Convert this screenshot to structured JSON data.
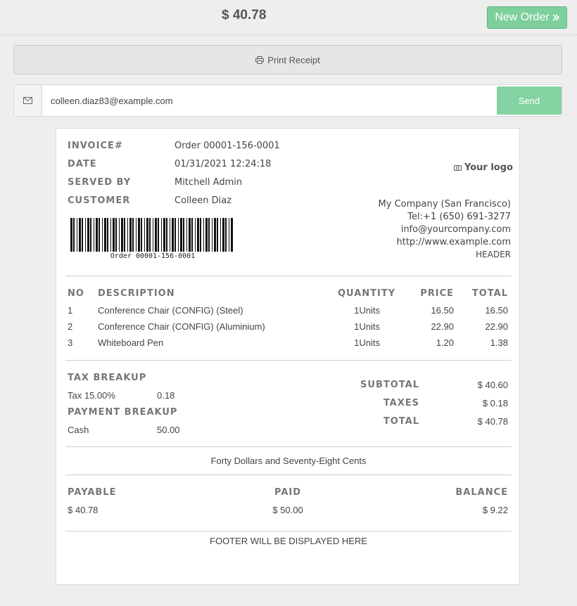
{
  "topbar": {
    "total": "$ 40.78",
    "new_order_label": "New Order"
  },
  "print": {
    "label": "Print Receipt"
  },
  "email": {
    "value": "colleen.diaz83@example.com",
    "send_label": "Send"
  },
  "receipt": {
    "meta": [
      {
        "label": "INVOICE#",
        "value": "Order 00001-156-0001"
      },
      {
        "label": "DATE",
        "value": "01/31/2021 12:24:18"
      },
      {
        "label": "SERVED BY",
        "value": "Mitchell Admin"
      },
      {
        "label": "CUSTOMER",
        "value": "Colleen Diaz"
      }
    ],
    "barcode_text": "Order 00001-156-0001",
    "logo_text": "Your logo",
    "company": {
      "name": "My Company (San Francisco)",
      "tel": "Tel:+1 (650) 691-3277",
      "email": "info@yourcompany.com",
      "website": "http://www.example.com",
      "header": "HEADER"
    },
    "columns": {
      "no": "NO",
      "description": "DESCRIPTION",
      "quantity": "QUANTITY",
      "price": "PRICE",
      "total": "TOTAL"
    },
    "lines": [
      {
        "no": "1",
        "description": "Conference Chair (CONFIG) (Steel)",
        "quantity": "1Units",
        "price": "16.50",
        "total": "16.50"
      },
      {
        "no": "2",
        "description": "Conference Chair (CONFIG) (Aluminium)",
        "quantity": "1Units",
        "price": "22.90",
        "total": "22.90"
      },
      {
        "no": "3",
        "description": "Whiteboard Pen",
        "quantity": "1Units",
        "price": "1.20",
        "total": "1.38"
      }
    ],
    "tax_breakup": {
      "title": "TAX BREAKUP",
      "name": "Tax 15.00%",
      "amount": "0.18"
    },
    "payment_breakup": {
      "title": "PAYMENT BREAKUP",
      "method": "Cash",
      "amount": "50.00"
    },
    "totals": {
      "subtotal_label": "SUBTOTAL",
      "subtotal": "$ 40.60",
      "taxes_label": "TAXES",
      "taxes": "$ 0.18",
      "total_label": "TOTAL",
      "total": "$ 40.78"
    },
    "amount_in_words": "Forty Dollars and Seventy-Eight Cents",
    "summary": {
      "payable_label": "PAYABLE",
      "payable": "$ 40.78",
      "paid_label": "PAID",
      "paid": "$ 50.00",
      "balance_label": "BALANCE",
      "balance": "$ 9.22"
    },
    "footer": "FOOTER WILL BE DISPLAYED HERE"
  },
  "icons": {
    "envelope": "envelope-icon",
    "print": "printer-icon",
    "chevrons": "double-chevron-right-icon",
    "camera": "camera-icon"
  }
}
